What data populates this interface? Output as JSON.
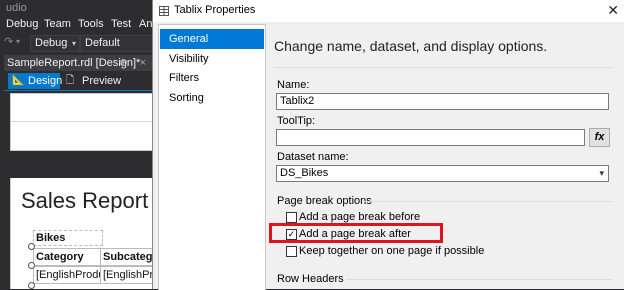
{
  "vs": {
    "title_fragment": "udio",
    "menu": [
      "Debug",
      "Team",
      "Tools",
      "Test",
      "Ana"
    ],
    "toolbar": {
      "config": "Debug",
      "platform": "Default"
    },
    "doc_tab": {
      "label": "SampleReport.rdl [Design]*",
      "pin": "⊕",
      "close": "×"
    },
    "view_tabs": {
      "design": "Design",
      "preview": "Preview"
    },
    "report": {
      "title": "Sales Report",
      "group_header": "Bikes",
      "columns": [
        "Category",
        "Subcatego"
      ],
      "cells": [
        "[EnglishProduct",
        "[EnglishPro"
      ]
    }
  },
  "dialog": {
    "title": "Tablix Properties",
    "close": "✕",
    "nav": [
      {
        "label": "General",
        "selected": true
      },
      {
        "label": "Visibility",
        "selected": false
      },
      {
        "label": "Filters",
        "selected": false
      },
      {
        "label": "Sorting",
        "selected": false
      }
    ],
    "heading": "Change name, dataset, and display options.",
    "name_label": "Name:",
    "name_value": "Tablix2",
    "tooltip_label": "ToolTip:",
    "tooltip_value": "",
    "fx_label": "fx",
    "dataset_label": "Dataset name:",
    "dataset_value": "DS_Bikes",
    "page_break_section": "Page break options",
    "checkboxes": [
      {
        "label": "Add a page break before",
        "checked": false
      },
      {
        "label": "Add a page break after",
        "checked": true
      },
      {
        "label": "Keep together on one page if possible",
        "checked": false
      }
    ],
    "row_headers_section": "Row Headers"
  },
  "colors": {
    "accent": "#0078d7",
    "highlight": "#e0141e",
    "vs_dark": "#2d2d30"
  }
}
